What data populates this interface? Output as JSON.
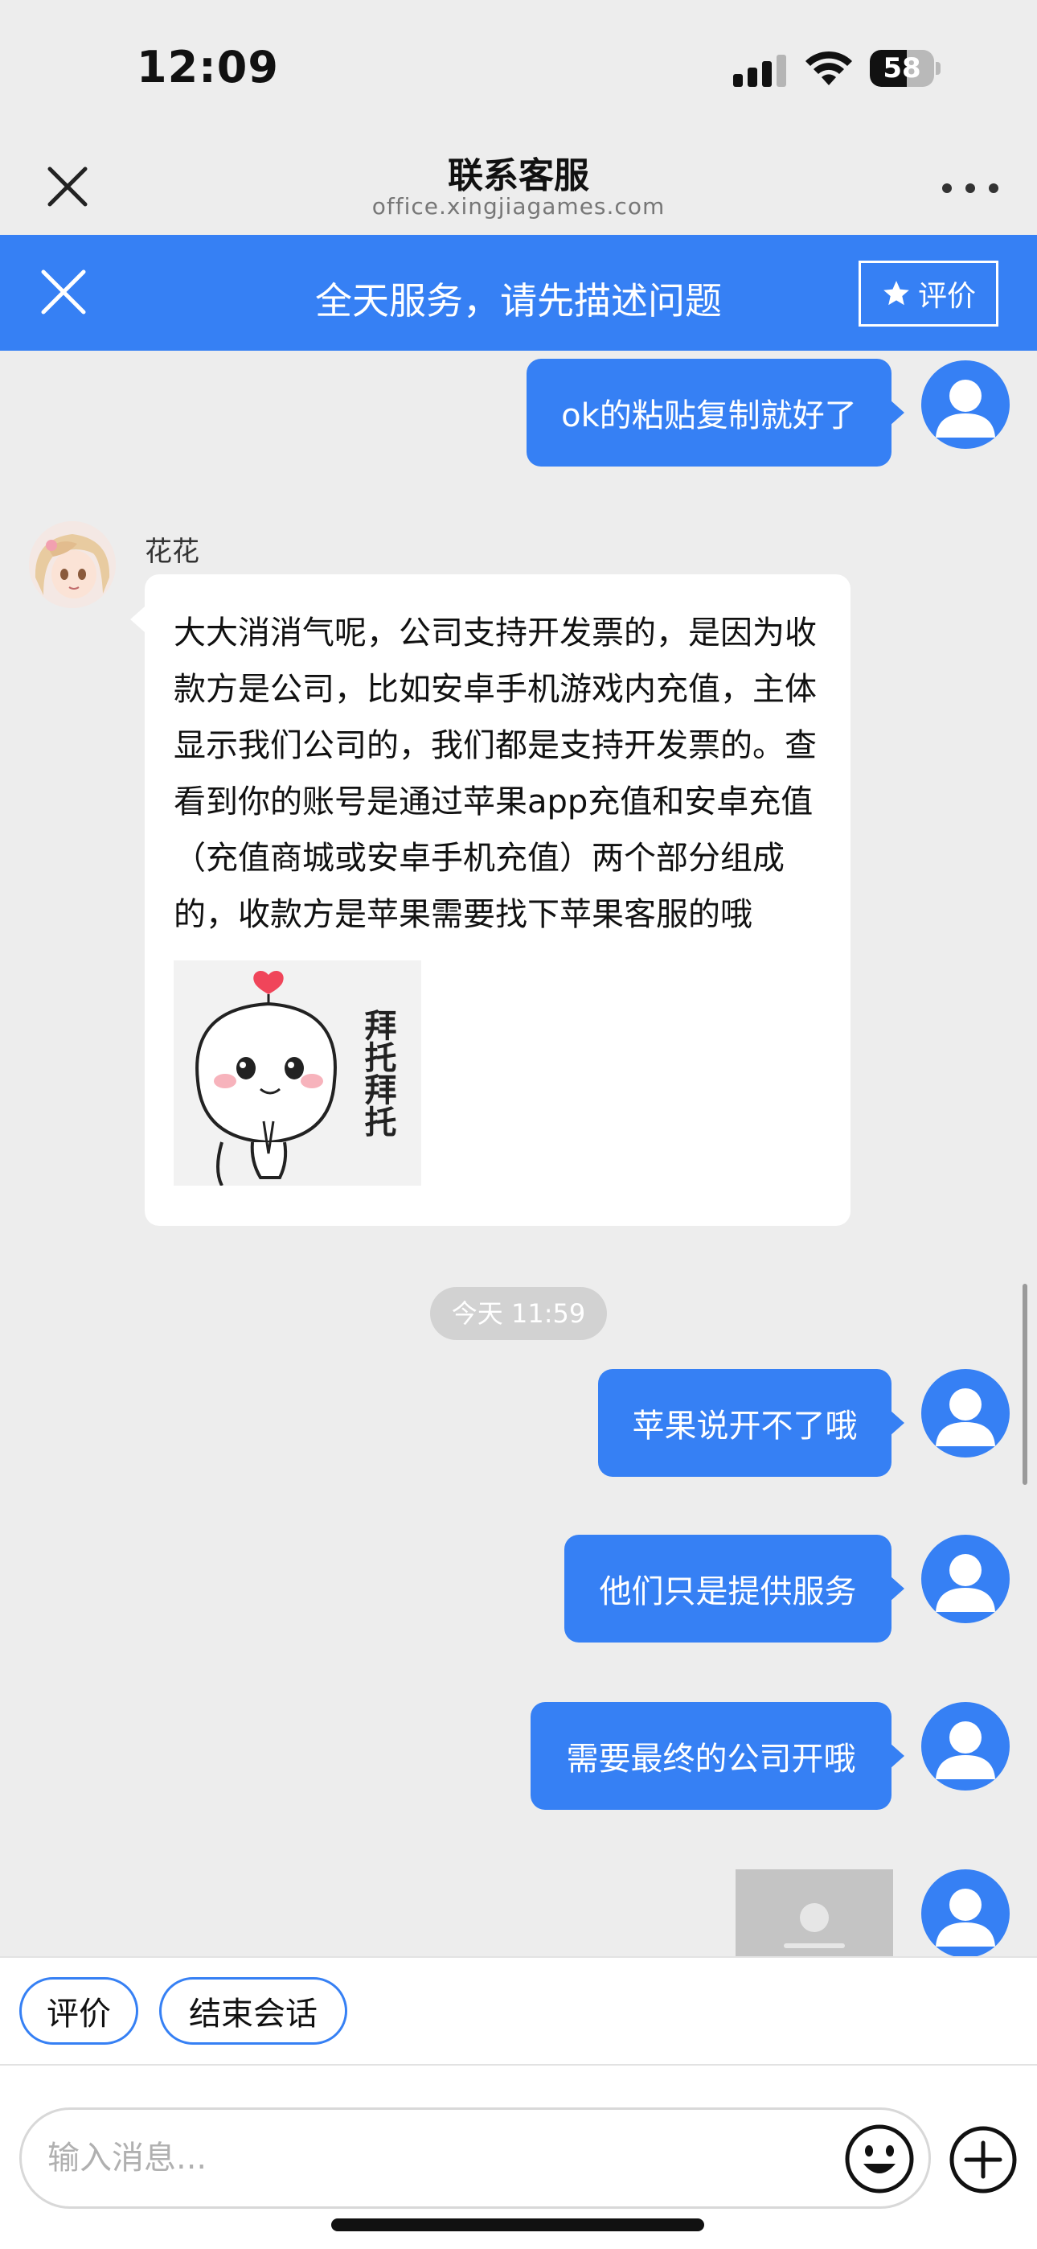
{
  "status_bar": {
    "time": "12:09",
    "battery_level": "58",
    "icons": [
      "cellular-signal-icon",
      "wifi-icon",
      "battery-icon"
    ]
  },
  "header": {
    "title": "联系客服",
    "domain": "office.xingjiagames.com",
    "icons": [
      "close-icon",
      "more-icon"
    ]
  },
  "banner": {
    "text": "全天服务，请先描述问题",
    "rate_label": "评价",
    "icons": [
      "close-icon",
      "star-icon"
    ],
    "color": "#3680f4"
  },
  "chat": {
    "messages_top": [
      {
        "text": "ok的粘贴复制就好了"
      }
    ],
    "agent": {
      "name": "花花",
      "message": "大大消消气呢，公司支持开发票的，是因为收款方是公司，比如安卓手机游戏内充值，主体显示我们公司的，我们都是支持开发票的。查看到你的账号是通过苹果app充值和安卓充值（充值商城或安卓手机充值）两个部分组成的，收款方是苹果需要找下苹果客服的哦",
      "sticker_text": "拜托拜托"
    },
    "timestamp": "今天 11:59",
    "messages_bottom": [
      {
        "text": "苹果说开不了哦"
      },
      {
        "text": "他们只是提供服务"
      },
      {
        "text": "需要最终的公司开哦"
      }
    ]
  },
  "quick_actions": {
    "rate_label": "评价",
    "end_label": "结束会话"
  },
  "input": {
    "placeholder": "输入消息...",
    "icons": [
      "emoji-icon",
      "plus-icon"
    ]
  },
  "colors": {
    "accent": "#3680f4",
    "background": "#ededed",
    "bubble_in": "#ffffff"
  }
}
